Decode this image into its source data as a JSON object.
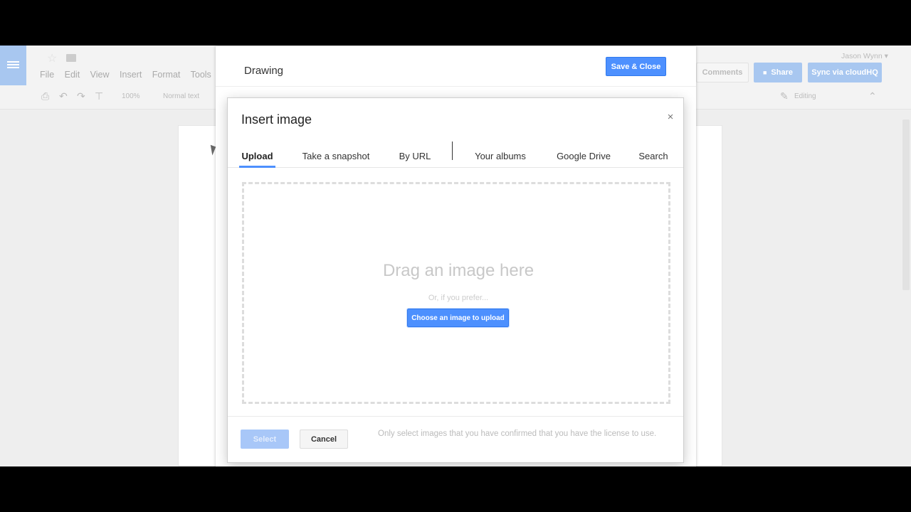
{
  "docs": {
    "menu": [
      "File",
      "Edit",
      "View",
      "Insert",
      "Format",
      "Tools"
    ],
    "user_name": "Jason Wynn",
    "comments_label": "Comments",
    "share_label": "Share",
    "sync_label": "Sync via cloudHQ",
    "toolbar": {
      "zoom": "100%",
      "style": "Normal text",
      "editing": "Editing"
    }
  },
  "drawing": {
    "title": "Drawing",
    "save_close_label": "Save & Close"
  },
  "insert_image": {
    "title": "Insert image",
    "close_glyph": "×",
    "tabs": [
      {
        "label": "Upload",
        "active": true
      },
      {
        "label": "Take a snapshot",
        "active": false
      },
      {
        "label": "By URL",
        "active": false
      },
      {
        "label": "Your albums",
        "active": false
      },
      {
        "label": "Google Drive",
        "active": false
      },
      {
        "label": "Search",
        "active": false
      }
    ],
    "drag_text": "Drag an image here",
    "prefer_text": "Or, if you prefer...",
    "choose_label": "Choose an image to upload",
    "select_label": "Select",
    "cancel_label": "Cancel",
    "license_text": "Only select images that you have confirmed that you have the license to use."
  },
  "colors": {
    "accent": "#4d90fe",
    "accent_border": "#3079ed",
    "disabled_accent": "#a8c7f8"
  }
}
